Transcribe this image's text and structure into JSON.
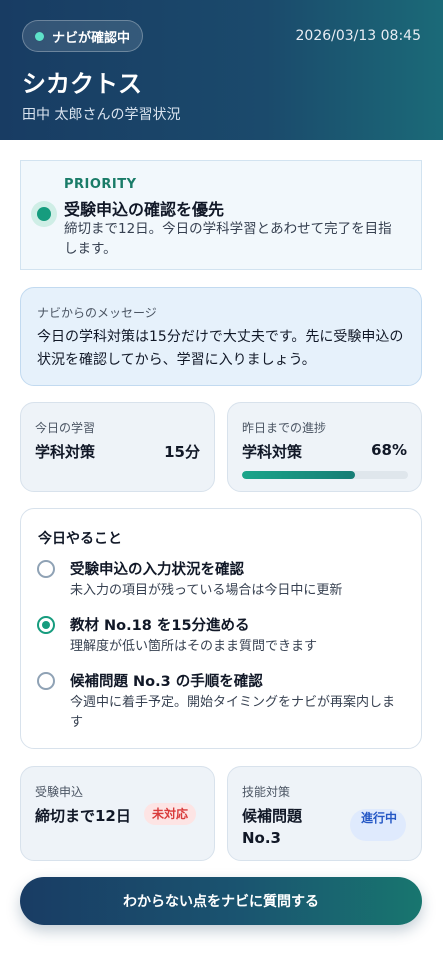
{
  "header": {
    "badge_label": "ナビが確認中",
    "datetime": "2026/03/13 08:45",
    "app_title": "シカクトス",
    "subtitle": "田中 太郎さんの学習状況"
  },
  "priority": {
    "label": "PRIORITY",
    "title": "受験申込の確認を優先",
    "description": "締切まで12日。今日の学科学習とあわせて完了を目指します。"
  },
  "message": {
    "label": "ナビからのメッセージ",
    "text": "今日の学科対策は15分だけで大丈夫です。先に受験申込の状況を確認してから、学習に入りましょう。"
  },
  "today_study": {
    "label": "今日の学習",
    "subject": "学科対策",
    "value": "15分"
  },
  "progress": {
    "label": "昨日までの進捗",
    "subject": "学科対策",
    "value": "68%",
    "percent": 68
  },
  "todo": {
    "title": "今日やること",
    "tasks": [
      {
        "title": "受験申込の入力状況を確認",
        "desc": "未入力の項目が残っている場合は今日中に更新",
        "checked": false
      },
      {
        "title": "教材 No.18 を15分進める",
        "desc": "理解度が低い箇所はそのまま質問できます",
        "checked": true
      },
      {
        "title": "候補問題 No.3 の手順を確認",
        "desc": "今週中に着手予定。開始タイミングをナビが再案内します",
        "checked": false
      }
    ]
  },
  "exam_application": {
    "label": "受験申込",
    "text": "締切まで12日",
    "status": "未対応"
  },
  "skill": {
    "label": "技能対策",
    "text": "候補問題 No.3",
    "status": "進行中"
  },
  "cta": {
    "label": "わからない点をナビに質問する"
  },
  "colors": {
    "accent_green": "#169c7e",
    "header_start": "#183c63",
    "header_end": "#1b6a78",
    "status_red": "#d93b3b",
    "status_blue": "#2457c5"
  }
}
